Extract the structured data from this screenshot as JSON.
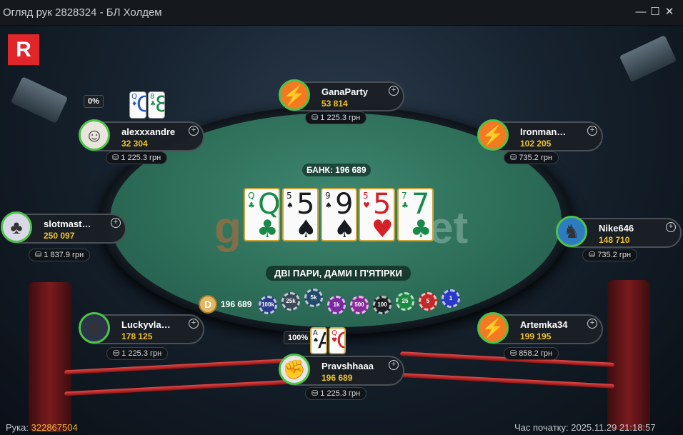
{
  "window": {
    "title": "Огляд рук 2828324 - БЛ Холдем",
    "minimize": "—",
    "maximize": "☐",
    "close": "✕"
  },
  "logo": "R",
  "table": {
    "brand_left": "g",
    "brand_right": "et",
    "pot_label": "БАНК: 196 689",
    "hand_result": "ДВІ ПАРИ, ДАМИ І П'ЯТІРКИ",
    "dealer": "D",
    "pot_amount": "196 689",
    "board": [
      {
        "rank": "Q",
        "suit": "♣",
        "color": "green"
      },
      {
        "rank": "5",
        "suit": "♠",
        "color": "black"
      },
      {
        "rank": "9",
        "suit": "♠",
        "color": "black"
      },
      {
        "rank": "5",
        "suit": "♥",
        "color": "red"
      },
      {
        "rank": "7",
        "suit": "♣",
        "color": "green"
      }
    ],
    "chips": [
      "100k",
      "25k",
      "5k",
      "1k",
      "500",
      "100",
      "25",
      "5",
      "1"
    ]
  },
  "players": [
    {
      "name": "GanaParty",
      "stack": "53 814",
      "bet": "1 225.3 грн",
      "avatar": "bolt-icon"
    },
    {
      "name": "alexxxandre",
      "stack": "32 304",
      "bet": "1 225.3 грн",
      "avatar": "person-avatar",
      "equity": "0%",
      "cards": [
        {
          "rank": "Q",
          "suit": "♦",
          "color": "blue"
        },
        {
          "rank": "8",
          "suit": "♣",
          "color": "green"
        }
      ]
    },
    {
      "name": "Ironman…",
      "stack": "102 205",
      "bet": "735.2 грн",
      "avatar": "bolt-icon"
    },
    {
      "name": "slotmast…",
      "stack": "250 097",
      "bet": "1 837.9 грн",
      "avatar": "chip-avatar"
    },
    {
      "name": "Nike646",
      "stack": "148 710",
      "bet": "735.2 грн",
      "avatar": "dragon-avatar"
    },
    {
      "name": "Luckyvla…",
      "stack": "178 125",
      "bet": "1 225.3 грн",
      "avatar": "beard-avatar"
    },
    {
      "name": "Artemka34",
      "stack": "199 195",
      "bet": "858.2 грн",
      "avatar": "bolt-icon"
    },
    {
      "name": "Pravshhaaa",
      "stack": "196 689",
      "bet": "1 225.3 грн",
      "avatar": "fist-avatar",
      "equity": "100%",
      "cards": [
        {
          "rank": "A",
          "suit": "♠",
          "color": "black"
        },
        {
          "rank": "Q",
          "suit": "♥",
          "color": "red"
        }
      ]
    }
  ],
  "footer": {
    "hand_label": "Рука:",
    "hand_id": "322867504",
    "start_label": "Час початку:",
    "start_time": "2025.11.29 21:18:57"
  },
  "colors": {
    "felt": "#2d6e58",
    "stack": "#f2c32c",
    "avatar_ring": "#4fc24b",
    "logo": "#e0262a"
  }
}
